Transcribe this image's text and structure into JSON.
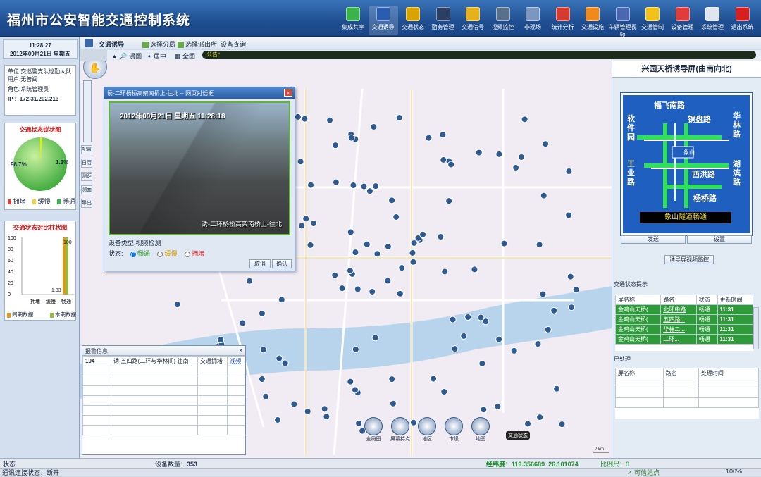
{
  "app": {
    "title": "福州市公安智能交通控制系统"
  },
  "nav": [
    {
      "label": "集成共享",
      "icon": "share-icon",
      "color": "#3bb34a"
    },
    {
      "label": "交通诱导",
      "icon": "guidance-icon",
      "color": "#2a5db0",
      "active": true
    },
    {
      "label": "交通状态",
      "icon": "traffic-state-icon",
      "color": "#d9a400"
    },
    {
      "label": "勤务管理",
      "icon": "police-icon",
      "color": "#2c3e63"
    },
    {
      "label": "交通信号",
      "icon": "signal-icon",
      "color": "#e6b21c"
    },
    {
      "label": "视频监控",
      "icon": "camera-icon",
      "color": "#5a6f8a"
    },
    {
      "label": "非现场",
      "icon": "offsite-icon",
      "color": "#7c96c2"
    },
    {
      "label": "统计分析",
      "icon": "chart-icon",
      "color": "#d63b2f"
    },
    {
      "label": "交通设施",
      "icon": "cone-icon",
      "color": "#f08a1c"
    },
    {
      "label": "车辆管理视频",
      "icon": "vehicle-video-icon",
      "color": "#4a68b2"
    },
    {
      "label": "交通管制",
      "icon": "barrier-icon",
      "color": "#f2c21a"
    },
    {
      "label": "设备管理",
      "icon": "tools-icon",
      "color": "#e23b3b"
    },
    {
      "label": "系统管理",
      "icon": "settings-icon",
      "color": "#dfe6f1"
    },
    {
      "label": "退出系统",
      "icon": "exit-icon",
      "color": "#d62020"
    }
  ],
  "clock": {
    "time": "11:28:27",
    "date": "2012年09月21日",
    "weekday": "星期五"
  },
  "user": {
    "unit_label": "单位:",
    "unit": "交巡警支队巡勤大队",
    "user_label": "用户:",
    "user": "无普闽",
    "role_label": "角色:",
    "role": "系统管理员",
    "ip_label": "IP :",
    "ip": "172.31.202.213"
  },
  "pie": {
    "title": "交通状态饼状图",
    "left_pct": "98.7%",
    "right_pct": "1.3%",
    "legend": [
      "拥堵",
      "缓慢",
      "畅通"
    ],
    "legend_colors": [
      "#e23b3b",
      "#f5d33b",
      "#36b54a"
    ],
    "value": 1.3
  },
  "bar": {
    "title": "交通状态对比柱状图",
    "yticks": [
      "100",
      "80",
      "60",
      "40",
      "20",
      "0"
    ],
    "categories": [
      "拥堵",
      "缓慢",
      "畅通"
    ],
    "series_colors": [
      "#e7941c",
      "#8fbf3c"
    ],
    "legend": [
      "同期数据",
      "本期数据"
    ],
    "top_label": "100",
    "bottom_label": "1.33"
  },
  "toolbar": {
    "tab_title": "交通诱导",
    "items": [
      "选择分局",
      "选择派出所",
      "设备查询"
    ],
    "mode_items": [
      "漫图",
      "居中",
      "全图"
    ],
    "notice_label": "公告："
  },
  "zoom_tools": [
    "配置",
    "日历",
    "测距",
    "测面",
    "导出"
  ],
  "dialog": {
    "title": "诱-二环杨桥高架南桥上-往北 -- 网页对话框",
    "video_caption": "诱-二环杨桥高架南桥上-往北",
    "video_time": "2012年09月21日 星期五 11:28:18",
    "device_type_label": "设备类型:",
    "device_type": "视频检测",
    "state_label": "状态:",
    "states": [
      "畅通",
      "缓慢",
      "拥堵"
    ],
    "cancel": "取消",
    "ok": "确认"
  },
  "alarm": {
    "title": "报警信息",
    "row": {
      "id": "104",
      "name": "诱-五四路(二环与华林间)-往南",
      "type": "交通拥堵",
      "action": "视频"
    }
  },
  "sign": {
    "title": "兴园天桥诱导屏(由南向北)",
    "labels": {
      "n": "福飞南路",
      "nw": "软件园",
      "ne": "铜盘路",
      "ne2": "华林路",
      "w": "工业路",
      "center": "象山",
      "e": "西洪路",
      "e2": "湖滨路",
      "se": "杨桥路",
      "bottom": "象山隧道畅通"
    },
    "send": "发送",
    "setting": "设置",
    "monitor": "诱导屏视频监控"
  },
  "status_table": {
    "title": "交通状态提示",
    "headers": [
      "屏名称",
      "路名",
      "状态",
      "更新时间"
    ],
    "rows": [
      [
        "金鸡山天桥(",
        "北环中路",
        "畅通",
        "11:31"
      ],
      [
        "金鸡山天桥(",
        "五四路...",
        "畅通",
        "11:31"
      ],
      [
        "金鸡山天桥(",
        "华林二...",
        "畅通",
        "11:31"
      ],
      [
        "金鸡山天桥(",
        "二环...",
        "畅通",
        "11:31"
      ]
    ]
  },
  "processed": {
    "title": "已处理",
    "headers": [
      "屏名称",
      "路名",
      "处理时间"
    ]
  },
  "bottom_tools": [
    "全局图",
    "屏幕持点",
    "地区",
    "市级",
    "地图"
  ],
  "map_tag": "交通状态",
  "status": {
    "label": "状态",
    "device_count_label": "设备数量：",
    "device_count": "353",
    "coords_label": "经纬度：",
    "lng": "119.356689",
    "lat": "26.101074",
    "scale_label": "比例尺：",
    "scale": "0",
    "conn": "通讯连接状态：断开",
    "site": "可信站点",
    "zoom": "100%",
    "scale_bar": "2 km"
  }
}
